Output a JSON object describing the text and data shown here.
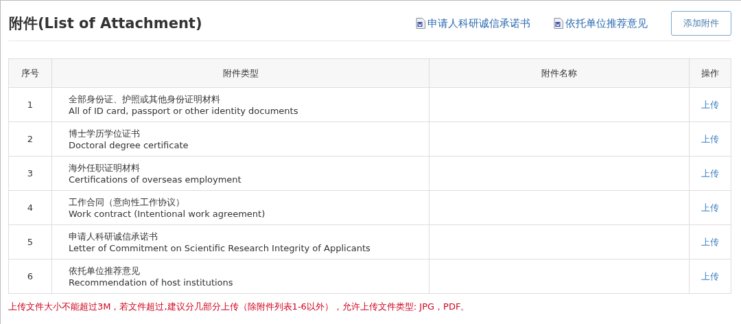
{
  "title": "附件(List of Attachment)",
  "links": [
    {
      "label": "申请人科研诚信承诺书"
    },
    {
      "label": "依托单位推荐意见"
    }
  ],
  "add_button": "添加附件",
  "table": {
    "columns": [
      "序号",
      "附件类型",
      "附件名称",
      "操作"
    ],
    "rows": [
      {
        "index": "1",
        "type_cn": "全部身份证、护照或其他身份证明材料",
        "type_en": "All of ID card, passport or other identity documents",
        "action": "上传"
      },
      {
        "index": "2",
        "type_cn": "博士学历学位证书",
        "type_en": "Doctoral degree certificate",
        "action": "上传"
      },
      {
        "index": "3",
        "type_cn": "海外任职证明材料",
        "type_en": "Certifications of overseas employment",
        "action": "上传"
      },
      {
        "index": "4",
        "type_cn": "工作合同（意向性工作协议）",
        "type_en": "Work contract (Intentional work agreement)",
        "action": "上传"
      },
      {
        "index": "5",
        "type_cn": "申请人科研诚信承诺书",
        "type_en": "Letter of Commitment on Scientific Research Integrity of Applicants",
        "action": "上传"
      },
      {
        "index": "6",
        "type_cn": "依托单位推荐意见",
        "type_en": "Recommendation of host institutions",
        "action": "上传"
      }
    ]
  },
  "note": "上传文件大小不能超过3M，若文件超过,建议分几部分上传（除附件列表1-6以外），允许上传文件类型: JPG，PDF。"
}
